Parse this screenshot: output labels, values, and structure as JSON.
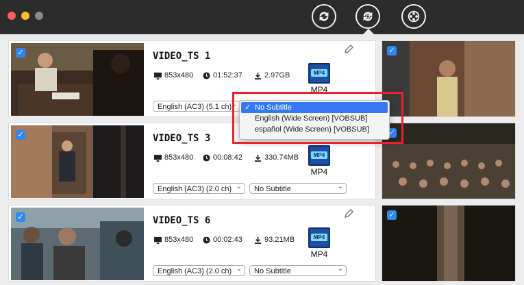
{
  "toolbar": {
    "buttons": [
      {
        "icon": "convert-icon"
      },
      {
        "icon": "convert-settings-icon"
      },
      {
        "icon": "film-reel-icon"
      }
    ]
  },
  "videos": [
    {
      "title": "VIDEO_TS 1",
      "resolution": "853x480",
      "duration": "01:52:37",
      "size": "2.97GB",
      "format": "MP4",
      "audio": "English (AC3) (5.1 ch)",
      "subtitle": "No Subtitle"
    },
    {
      "title": "VIDEO_TS 3",
      "resolution": "853x480",
      "duration": "00:08:42",
      "size": "330.74MB",
      "format": "MP4",
      "audio": "English (AC3) (2.0 ch)",
      "subtitle": "No Subtitle"
    },
    {
      "title": "VIDEO_TS 6",
      "resolution": "853x480",
      "duration": "00:02:43",
      "size": "93.21MB",
      "format": "MP4",
      "audio": "English (AC3) (2.0 ch)",
      "subtitle": "No Subtitle"
    }
  ],
  "subtitle_dropdown": {
    "options": [
      "No Subtitle",
      "English (Wide Screen) [VOBSUB]",
      "español (Wide Screen) [VOBSUB]"
    ],
    "selected_index": 0
  },
  "colors": {
    "accent": "#3478f6",
    "highlight": "#e8222e",
    "titlebar": "#2c2c2c"
  }
}
